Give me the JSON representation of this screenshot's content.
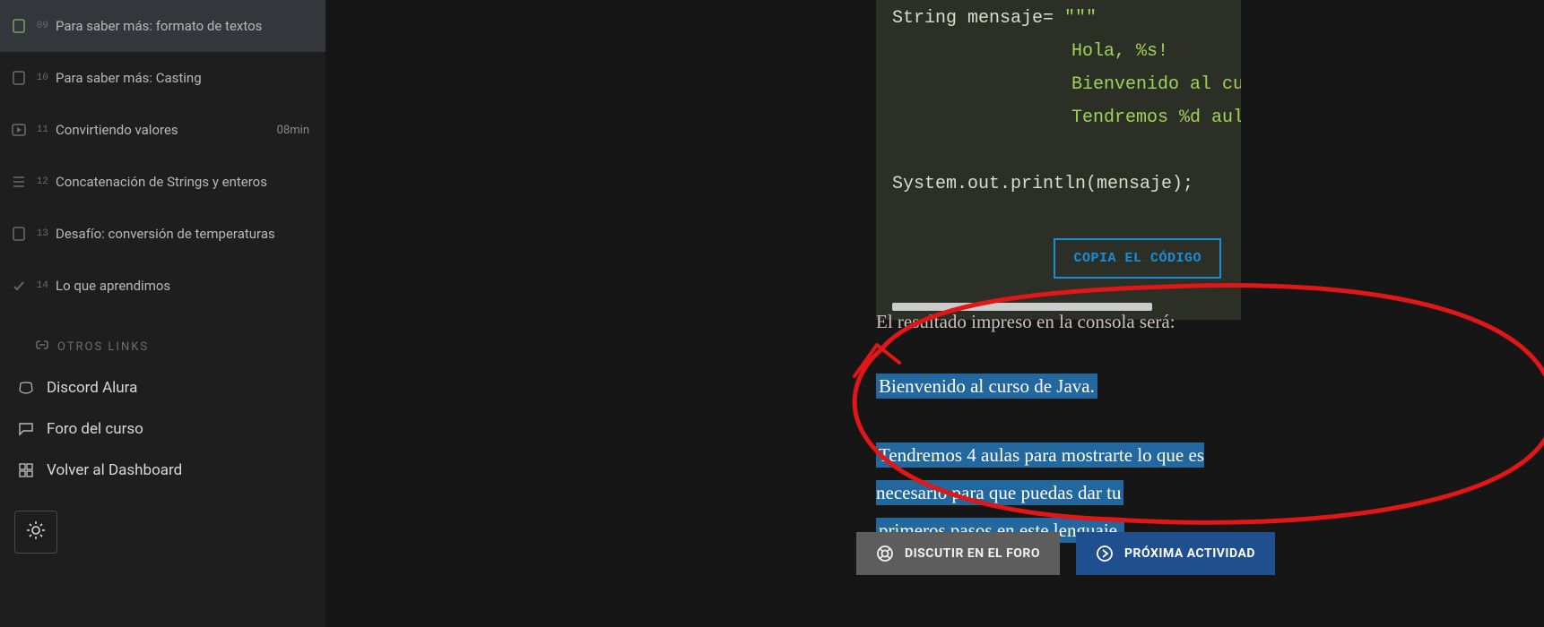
{
  "sidebar": {
    "items": [
      {
        "idx": "09",
        "label": "Para saber más: formato de textos",
        "duration": "",
        "icon": "file",
        "active": true
      },
      {
        "idx": "10",
        "label": "Para saber más: Casting",
        "duration": "",
        "icon": "file",
        "active": false
      },
      {
        "idx": "11",
        "label": "Convirtiendo valores",
        "duration": "08min",
        "icon": "video",
        "active": false
      },
      {
        "idx": "12",
        "label": "Concatenación de Strings y enteros",
        "duration": "",
        "icon": "list",
        "active": false
      },
      {
        "idx": "13",
        "label": "Desafío: conversión de temperaturas",
        "duration": "",
        "icon": "file",
        "active": false
      },
      {
        "idx": "14",
        "label": "Lo que aprendimos",
        "duration": "",
        "icon": "check",
        "active": false
      }
    ],
    "section_header": "OTROS LINKS",
    "links": [
      {
        "label": "Discord Alura",
        "icon": "discord"
      },
      {
        "label": "Foro del curso",
        "icon": "forum"
      },
      {
        "label": "Volver al Dashboard",
        "icon": "dashboard"
      }
    ]
  },
  "code": {
    "line1_a": "String mensaje= ",
    "line1_b": "\"\"\"",
    "line2": "Hola, %s!",
    "line3": "Bienvenido al curso de Java.",
    "line4": "Tendremos %d aulas para mostrarte lo que es ne",
    "line6": "System.out.println(mensaje);",
    "copy_label": "COPIA EL CÓDIGO"
  },
  "content": {
    "intro": "El resultado impreso en la consola será:",
    "hl1": "Bienvenido al curso de Java.",
    "hl2a": "Tendremos 4 aulas para mostrarte lo que es necesario para que puedas dar tu",
    "hl2b": "primeros pasos en este lenguaje."
  },
  "buttons": {
    "discuss": "DISCUTIR EN EL FORO",
    "next": "PRÓXIMA ACTIVIDAD"
  }
}
